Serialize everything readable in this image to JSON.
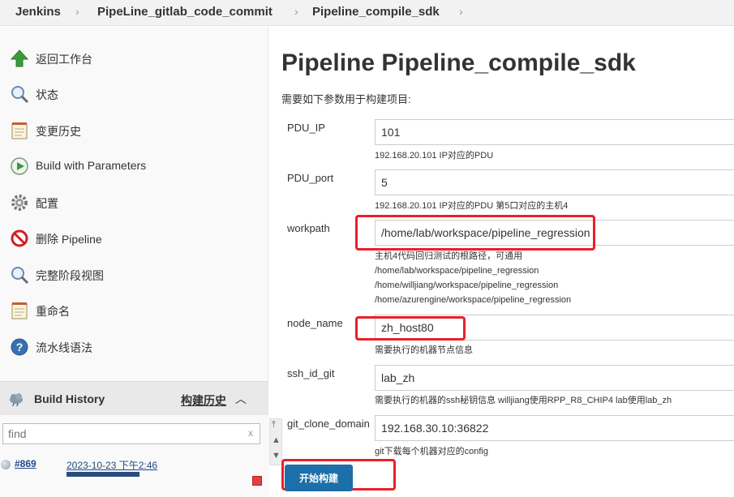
{
  "breadcrumb": {
    "items": [
      "Jenkins",
      "PipeLine_gitlab_code_commit",
      "Pipeline_compile_sdk"
    ]
  },
  "sidebar": {
    "tasks": [
      {
        "label": "返回工作台",
        "icon": "up-arrow-icon"
      },
      {
        "label": "状态",
        "icon": "magnifier-icon"
      },
      {
        "label": "变更历史",
        "icon": "notepad-icon"
      },
      {
        "label": "Build with Parameters",
        "icon": "clock-play-icon"
      },
      {
        "label": "配置",
        "icon": "gear-icon"
      },
      {
        "label": "删除 Pipeline",
        "icon": "no-entry-icon"
      },
      {
        "label": "完整阶段视图",
        "icon": "magnifier-icon"
      },
      {
        "label": "重命名",
        "icon": "notepad-icon"
      },
      {
        "label": "流水线语法",
        "icon": "help-icon"
      }
    ],
    "build_history": {
      "title": "Build History",
      "trend_label": "构建历史",
      "filter_placeholder": "find",
      "filter_clear": "x",
      "builds": [
        {
          "number": "#869",
          "date": "2023-10-23 下午2:46",
          "progress": 0.8
        }
      ]
    }
  },
  "main": {
    "title": "Pipeline Pipeline_compile_sdk",
    "intro": "需要如下参数用于构建项目:",
    "params": [
      {
        "name": "PDU_IP",
        "value": "101",
        "desc": [
          "192.168.20.101 IP对应的PDU"
        ]
      },
      {
        "name": "PDU_port",
        "value": "5",
        "desc": [
          "192.168.20.101 IP对应的PDU 第5口对应的主机4"
        ]
      },
      {
        "name": "workpath",
        "value": "/home/lab/workspace/pipeline_regression",
        "desc": [
          "主机4代码回归测试的根路径，可通用",
          "/home/lab/workspace/pipeline_regression",
          "/home/willjiang/workspace/pipeline_regression",
          "/home/azurengine/workspace/pipeline_regression"
        ]
      },
      {
        "name": "node_name",
        "value": "zh_host80",
        "desc": [
          "需要执行的机器节点信息"
        ]
      },
      {
        "name": "ssh_id_git",
        "value": "lab_zh",
        "desc": [
          "需要执行的机器的ssh秘钥信息  willjiang使用RPP_R8_CHIP4  lab使用lab_zh"
        ]
      },
      {
        "name": "git_clone_domain",
        "value": "192.168.30.10:36822",
        "desc": [
          "git下载每个机器对应的config"
        ]
      }
    ],
    "build_button": "开始构建"
  },
  "colors": {
    "highlight": "#e8202a",
    "button": "#1c6fa8",
    "link": "#204a87"
  }
}
